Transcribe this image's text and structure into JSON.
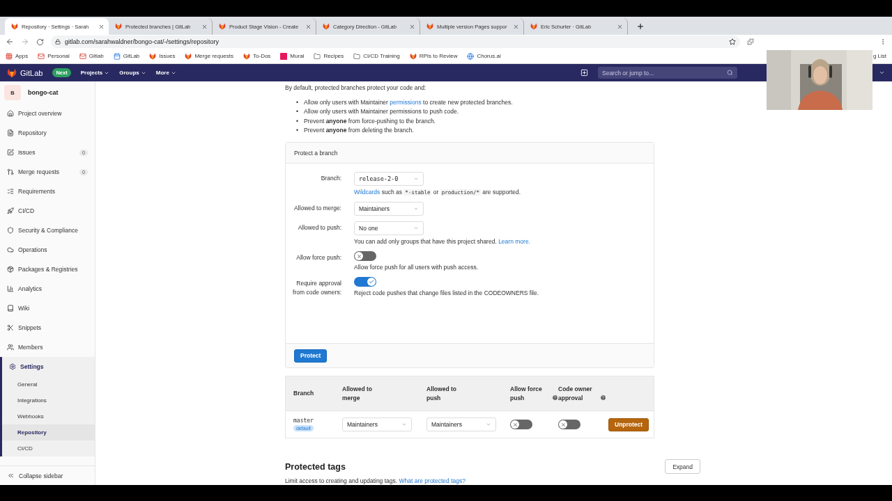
{
  "browser": {
    "tabs": [
      {
        "title": "Repository · Settings · Sarah",
        "selected": true
      },
      {
        "title": "Protected branches | GitLab",
        "selected": false
      },
      {
        "title": "Product Stage Vision - Create",
        "selected": false
      },
      {
        "title": "Category Direction - GitLab",
        "selected": false
      },
      {
        "title": "Multiple version Pages suppor",
        "selected": false
      },
      {
        "title": "Eric Schurter · GitLab",
        "selected": false
      }
    ],
    "address": "gitlab.com/sarahwaldner/bongo-cat/-/settings/repository",
    "bookmarks": [
      {
        "label": "Apps",
        "kind": "apps"
      },
      {
        "label": "Personal",
        "kind": "mail"
      },
      {
        "label": "Gitlab",
        "kind": "mail"
      },
      {
        "label": "GitLab",
        "kind": "calendar"
      },
      {
        "label": "Issues",
        "kind": "fox"
      },
      {
        "label": "Merge requests",
        "kind": "fox"
      },
      {
        "label": "To-Dos",
        "kind": "fox"
      },
      {
        "label": "Mural",
        "kind": "mural"
      },
      {
        "label": "Recipes",
        "kind": "folder"
      },
      {
        "label": "CI/CD Training",
        "kind": "folder"
      },
      {
        "label": "RPIs to Review",
        "kind": "fox"
      },
      {
        "label": "Chorus.ai",
        "kind": "globe"
      }
    ],
    "bookmark_cut": "g List"
  },
  "nav": {
    "brand": "GitLab",
    "badge": "Next",
    "menus": [
      "Projects",
      "Groups",
      "More"
    ],
    "search": {
      "placeholder": "Search or jump to..."
    }
  },
  "sidebar": {
    "project": {
      "initial": "B",
      "name": "bongo-cat"
    },
    "items": [
      {
        "label": "Project overview",
        "selected": false
      },
      {
        "label": "Repository",
        "selected": false
      },
      {
        "label": "Issues",
        "count": "0",
        "selected": false
      },
      {
        "label": "Merge requests",
        "count": "0",
        "selected": false
      },
      {
        "label": "Requirements",
        "selected": false
      },
      {
        "label": "CI/CD",
        "selected": false
      },
      {
        "label": "Security & Compliance",
        "selected": false
      },
      {
        "label": "Operations",
        "selected": false
      },
      {
        "label": "Packages & Registries",
        "selected": false
      },
      {
        "label": "Analytics",
        "selected": false
      },
      {
        "label": "Wiki",
        "selected": false
      },
      {
        "label": "Snippets",
        "selected": false
      },
      {
        "label": "Members",
        "selected": false
      },
      {
        "label": "Settings",
        "selected": true,
        "expanded": true,
        "children": [
          {
            "label": "General",
            "selected": false
          },
          {
            "label": "Integrations",
            "selected": false
          },
          {
            "label": "Webhooks",
            "selected": false
          },
          {
            "label": "Repository",
            "selected": true
          },
          {
            "label": "CI/CD",
            "selected": false
          }
        ]
      }
    ],
    "collapse": "Collapse sidebar"
  },
  "intro": "By default, protected branches protect your code and:",
  "bullets": [
    {
      "marker": "•",
      "text": "Allow only users with Maintainer ",
      "link": "permissions",
      "after": " to create new protected branches."
    },
    {
      "marker": "•",
      "text": "Allow only users with Maintainer permissions to push code."
    },
    {
      "marker": "•",
      "text": "Prevent **anyone** from force-pushing to the branch."
    },
    {
      "marker": "•",
      "text": "Prevent **anyone** from deleting the branch."
    }
  ],
  "protect_form": {
    "title": "Protect a branch",
    "fields": [
      {
        "label": "Branch:",
        "kind": "select",
        "value": "release-2-0",
        "mono": true,
        "help": [
          {
            "kind": "link",
            "text": "Wildcards"
          },
          {
            "kind": "text",
            "text": " such as "
          },
          {
            "kind": "code",
            "text": "*-stable"
          },
          {
            "kind": "text",
            "text": " or "
          },
          {
            "kind": "code",
            "text": "production/*"
          },
          {
            "kind": "text",
            "text": " are supported."
          }
        ]
      },
      {
        "label": "Allowed to merge:",
        "kind": "select",
        "value": "Maintainers",
        "mono": false
      },
      {
        "label": "Allowed to push:",
        "kind": "select",
        "value": "No one",
        "mono": false,
        "help": [
          {
            "kind": "text",
            "text": "You can add only groups that have this project shared. "
          },
          {
            "kind": "link",
            "text": "Learn more."
          }
        ]
      },
      {
        "label": "Allow force push:",
        "kind": "toggle",
        "checked": false,
        "help": [
          {
            "kind": "text",
            "text": "Allow force push for all users with push access."
          }
        ]
      },
      {
        "label": "Require approval from code owners:",
        "kind": "toggle",
        "checked": true,
        "help": [
          {
            "kind": "text",
            "text": "Reject code pushes that change files listed in the CODEOWNERS file."
          }
        ]
      }
    ],
    "submit": "Protect"
  },
  "table": {
    "columns": [
      {
        "label": "Branch"
      },
      {
        "label": "Allowed to merge"
      },
      {
        "label": "Allowed to push"
      },
      {
        "label": "Allow force push",
        "help": true
      },
      {
        "label": "Code owner approval",
        "help": true
      }
    ],
    "rows": [
      {
        "branch": "master",
        "badge": "default",
        "merge": "Maintainers",
        "push": "Maintainers",
        "force_push": false,
        "code_owner": false,
        "action": "Unprotect"
      }
    ]
  },
  "tags_section": {
    "title": "Protected tags",
    "button": "Expand",
    "text": "Limit access to creating and updating tags. ",
    "link": "What are protected tags?"
  }
}
